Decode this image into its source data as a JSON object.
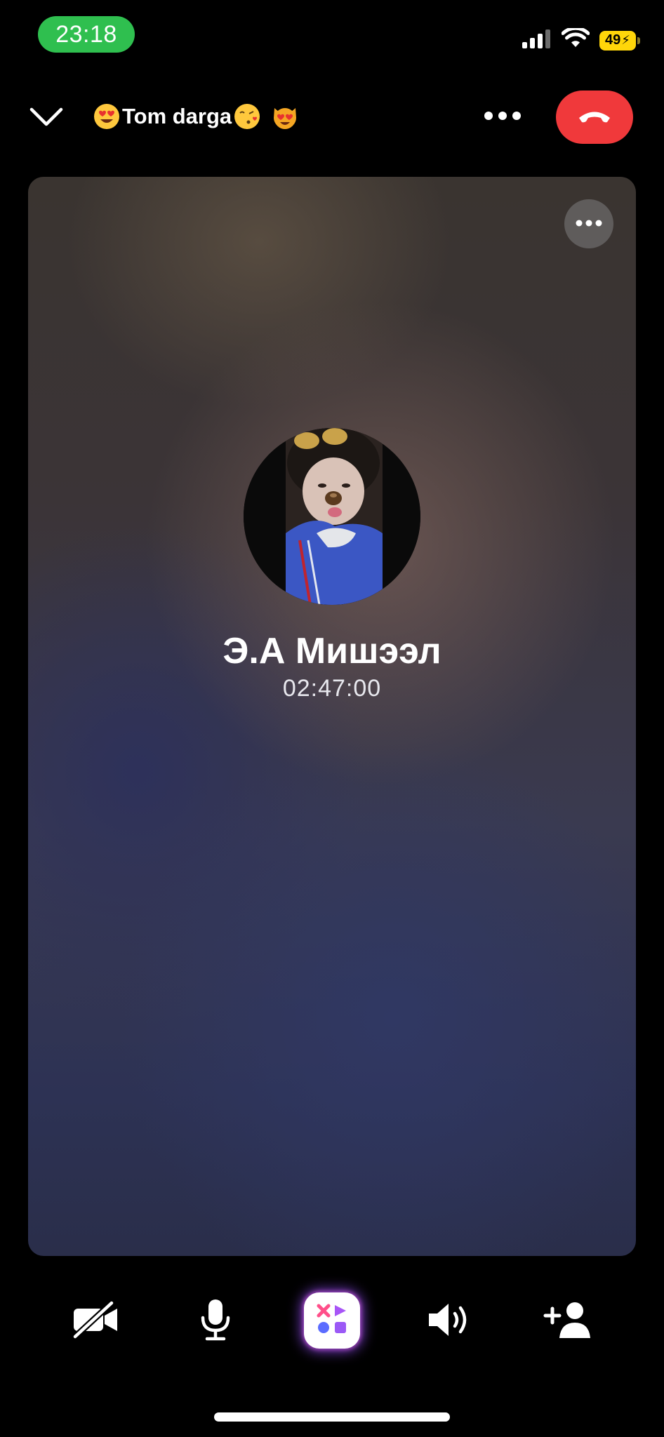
{
  "status_bar": {
    "time": "23:18",
    "battery_level": "49",
    "battery_charging": true,
    "cellular_icon": "cellular-signal-icon",
    "wifi_icon": "wifi-icon",
    "colors": {
      "time_pill": "#2fbf4f",
      "battery": "#ffd60a"
    }
  },
  "header": {
    "collapse_icon": "chevron-down-icon",
    "title_emoji_left": "heart-eyes-emoji",
    "title": "Tom darga",
    "title_emoji_right": [
      "kissing-face-emoji",
      "heart-eyes-cat-emoji"
    ],
    "more_icon": "more-horizontal-icon",
    "end_call_icon": "phone-hangup-icon",
    "colors": {
      "end_call": "#f0393b"
    }
  },
  "call": {
    "card_more_icon": "more-horizontal-icon",
    "caller_name": "Э.А Мишээл",
    "duration": "02:47:00",
    "avatar_icon": "user-avatar-photo"
  },
  "controls": [
    {
      "id": "camera-off",
      "icon": "video-off-icon"
    },
    {
      "id": "microphone",
      "icon": "microphone-icon"
    },
    {
      "id": "effects",
      "icon": "effects-apps-icon"
    },
    {
      "id": "speaker",
      "icon": "speaker-volume-icon"
    },
    {
      "id": "add-person",
      "icon": "add-person-icon"
    }
  ]
}
